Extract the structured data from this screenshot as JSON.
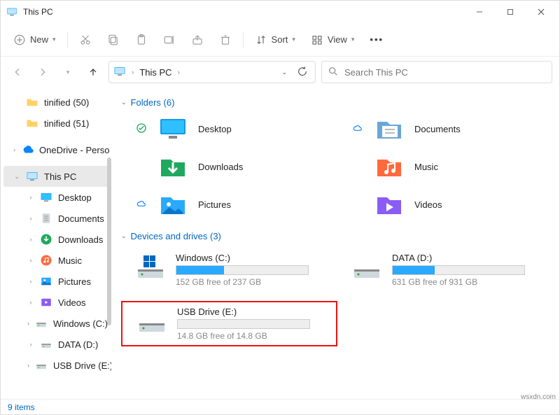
{
  "window": {
    "title": "This PC"
  },
  "toolbar": {
    "new_label": "New",
    "sort_label": "Sort",
    "view_label": "View"
  },
  "nav": {
    "breadcrumb": "This PC",
    "search_placeholder": "Search This PC"
  },
  "sidebar": {
    "items": [
      {
        "label": "tinified (50)",
        "type": "folder"
      },
      {
        "label": "tinified (51)",
        "type": "folder"
      },
      {
        "label": "OneDrive - Perso",
        "type": "onedrive",
        "caret": ">"
      },
      {
        "label": "This PC",
        "type": "thispc",
        "caret": "v",
        "selected": true
      },
      {
        "label": "Desktop",
        "type": "desktop",
        "caret": ">"
      },
      {
        "label": "Documents",
        "type": "documents",
        "caret": ">"
      },
      {
        "label": "Downloads",
        "type": "downloads",
        "caret": ">"
      },
      {
        "label": "Music",
        "type": "music",
        "caret": ">"
      },
      {
        "label": "Pictures",
        "type": "pictures",
        "caret": ">"
      },
      {
        "label": "Videos",
        "type": "videos",
        "caret": ">"
      },
      {
        "label": "Windows (C:)",
        "type": "drive",
        "caret": ">"
      },
      {
        "label": "DATA (D:)",
        "type": "drive",
        "caret": ">"
      },
      {
        "label": "USB Drive (E:)",
        "type": "usb",
        "caret": ">"
      }
    ]
  },
  "groups": {
    "folders_header": "Folders (6)",
    "drives_header": "Devices and drives (3)"
  },
  "folders": [
    {
      "name": "Desktop",
      "sync": "check"
    },
    {
      "name": "Documents",
      "sync": "cloud"
    },
    {
      "name": "Downloads",
      "sync": ""
    },
    {
      "name": "Music",
      "sync": ""
    },
    {
      "name": "Pictures",
      "sync": "cloud"
    },
    {
      "name": "Videos",
      "sync": ""
    }
  ],
  "drives": [
    {
      "name": "Windows (C:)",
      "free": "152 GB free of 237 GB",
      "fill_pct": 36,
      "os": true
    },
    {
      "name": "DATA (D:)",
      "free": "631 GB free of 931 GB",
      "fill_pct": 32
    },
    {
      "name": "USB Drive (E:)",
      "free": "14.8 GB free of 14.8 GB",
      "fill_pct": 0,
      "highlight": true
    }
  ],
  "status": {
    "text": "9 items"
  },
  "watermark": "wsxdn.com"
}
